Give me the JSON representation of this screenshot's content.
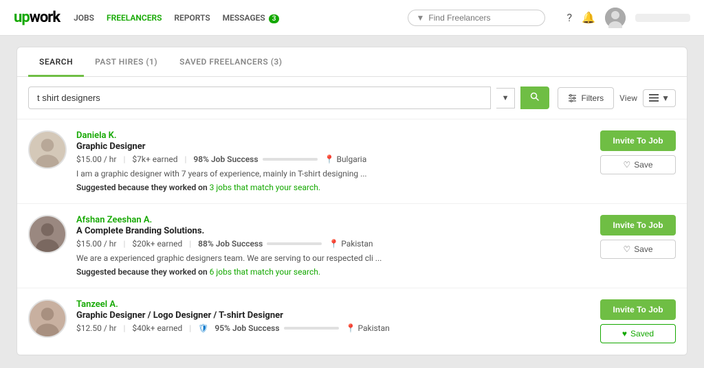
{
  "nav": {
    "logo": "up",
    "logo_suffix": "work",
    "links": [
      {
        "label": "JOBS",
        "green": false
      },
      {
        "label": "FREELANCERS",
        "green": true
      },
      {
        "label": "REPORTS",
        "green": false
      },
      {
        "label": "MESSAGES",
        "green": false,
        "badge": "3"
      }
    ],
    "search_placeholder": "Find Freelancers",
    "icons": [
      "?",
      "🔔",
      "👤"
    ],
    "username_placeholder": "user name"
  },
  "tabs": [
    {
      "label": "SEARCH",
      "active": true
    },
    {
      "label": "PAST HIRES (1)",
      "active": false
    },
    {
      "label": "SAVED FREELANCERS (3)",
      "active": false
    }
  ],
  "search": {
    "value": "t shirt designers",
    "filters_label": "Filters",
    "view_label": "View"
  },
  "freelancers": [
    {
      "name": "Daniela K.",
      "title": "Graphic Designer",
      "rate": "$15.00 / hr",
      "earned": "$7k+ earned",
      "job_success": "98% Job Success",
      "job_success_pct": 98,
      "location": "Bulgaria",
      "bio": "I am a graphic designer with 7 years of experience, mainly in T-shirt designing ...",
      "suggested": "Suggested because they worked on ",
      "suggested_link": "3 jobs that match your search.",
      "invite_label": "Invite To Job",
      "save_label": "Save",
      "saved": false,
      "avatar_color": "#d4c8b8",
      "progress_color": "green"
    },
    {
      "name": "Afshan Zeeshan A.",
      "title": "A Complete Branding Solutions.",
      "rate": "$15.00 / hr",
      "earned": "$20k+ earned",
      "job_success": "88% Job Success",
      "job_success_pct": 88,
      "location": "Pakistan",
      "bio": "We are a experienced graphic designers team. We are serving to our respected cli ...",
      "suggested": "Suggested because they worked on ",
      "suggested_link": "6 jobs that match your search.",
      "invite_label": "Invite To Job",
      "save_label": "Save",
      "saved": false,
      "avatar_color": "#b8a898",
      "progress_color": "green"
    },
    {
      "name": "Tanzeel A.",
      "title": "Graphic Designer / Logo Designer / T-shirt Designer",
      "rate": "$12.50 / hr",
      "earned": "$40k+ earned",
      "job_success": "95% Job Success",
      "job_success_pct": 95,
      "location": "Pakistan",
      "bio": "",
      "suggested": "",
      "suggested_link": "",
      "invite_label": "Invite To Job",
      "save_label": "Saved",
      "saved": true,
      "avatar_color": "#c8b0a0",
      "progress_color": "blue"
    }
  ]
}
